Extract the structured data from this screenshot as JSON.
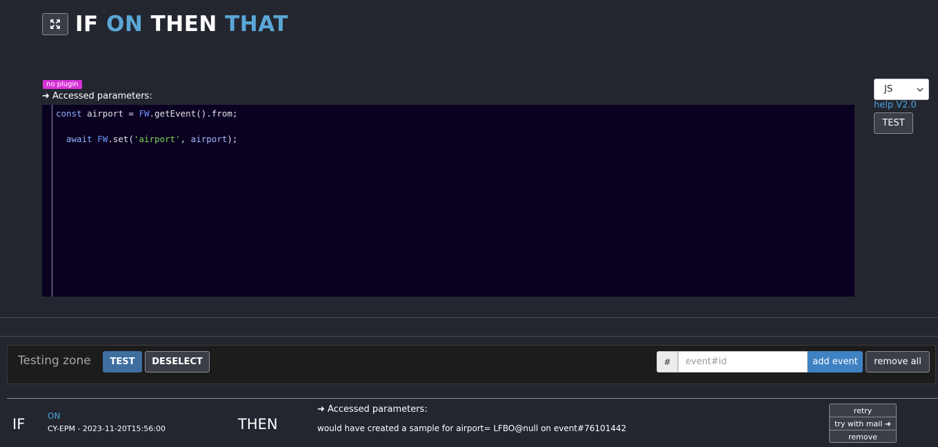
{
  "header": {
    "title_parts": [
      "IF",
      "ON",
      "THEN",
      "THAT"
    ],
    "expand_icon": "expand-icon"
  },
  "editor": {
    "badge": "no plugin",
    "params_label": "➜ Accessed parameters:",
    "code": {
      "line1": {
        "kw": "const",
        "a": " airport = ",
        "fw": "FW",
        "b": ".getEvent().from;"
      },
      "line2": {
        "kw": "await",
        "a": " ",
        "fw": "FW",
        "b": ".set(",
        "str": "'airport'",
        "c": ", ",
        "var": "airport",
        "d": ");"
      }
    }
  },
  "side": {
    "language": "JS",
    "help": "help V2.0",
    "test": "TEST"
  },
  "testing_zone": {
    "label": "Testing zone",
    "test": "TEST",
    "deselect": "DESELECT",
    "hash": "#",
    "event_placeholder": "event#id",
    "add_event": "add event",
    "remove_all": "remove all"
  },
  "result": {
    "if": "IF",
    "on": "ON",
    "event": "CY-EPM - 2023-11-20T15:56:00",
    "then": "THEN",
    "params": "➜ Accessed parameters:",
    "message": "would have created a sample for airport= LFBO@null on event#76101442",
    "actions": [
      "retry",
      "try with mail ➜",
      "remove"
    ]
  },
  "colors": {
    "accent_blue": "#5aa7d6",
    "badge": "#d633d6",
    "code_bg": "#0a0120",
    "primary_button": "#3f6fa0"
  }
}
